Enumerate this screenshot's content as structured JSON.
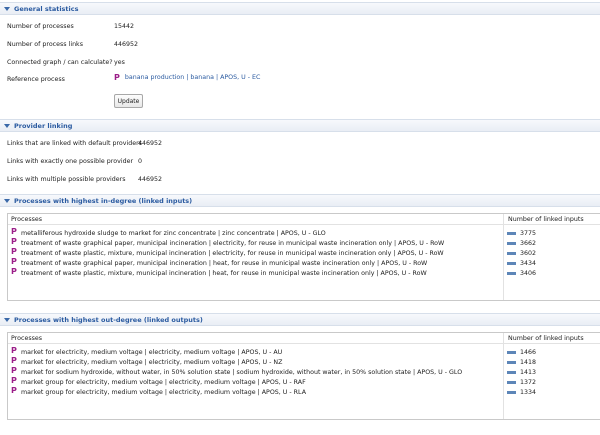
{
  "general": {
    "title": "General statistics",
    "num_processes_label": "Number of processes",
    "num_processes_value": "15442",
    "num_links_label": "Number of process links",
    "num_links_value": "446952",
    "connected_label": "Connected graph / can calculate?",
    "connected_value": "yes",
    "ref_label": "Reference process",
    "ref_value": "banana production | banana | APOS, U - EC",
    "update_label": "Update"
  },
  "linking": {
    "title": "Provider linking",
    "default_label": "Links that are linked with default providers",
    "default_value": "446952",
    "one_label": "Links with exactly one possible provider",
    "one_value": "0",
    "multiple_label": "Links with multiple possible providers",
    "multiple_value": "446952"
  },
  "indegree": {
    "title": "Processes with highest in-degree (linked inputs)",
    "col_processes": "Processes",
    "col_count": "Number of linked inputs",
    "rows": [
      {
        "name": "metalliferous hydroxide sludge to market for zinc concentrate | zinc concentrate | APOS, U - GLO",
        "count": "3775"
      },
      {
        "name": "treatment of waste graphical paper, municipal incineration | electricity, for reuse in municipal waste incineration only | APOS, U - RoW",
        "count": "3662"
      },
      {
        "name": "treatment of waste plastic, mixture, municipal incineration | electricity, for reuse in municipal waste incineration only | APOS, U - RoW",
        "count": "3602"
      },
      {
        "name": "treatment of waste graphical paper, municipal incineration | heat, for reuse in municipal waste incineration only | APOS, U - RoW",
        "count": "3434"
      },
      {
        "name": "treatment of waste plastic, mixture, municipal incineration | heat, for reuse in municipal waste incineration only | APOS, U - RoW",
        "count": "3406"
      }
    ]
  },
  "outdegree": {
    "title": "Processes with highest out-degree (linked outputs)",
    "col_processes": "Processes",
    "col_count": "Number of linked inputs",
    "rows": [
      {
        "name": "market for electricity, medium voltage | electricity, medium voltage | APOS, U - AU",
        "count": "1466"
      },
      {
        "name": "market for electricity, medium voltage | electricity, medium voltage | APOS, U - NZ",
        "count": "1418"
      },
      {
        "name": "market for sodium hydroxide, without water, in 50% solution state | sodium hydroxide, without water, in 50% solution state | APOS, U - GLO",
        "count": "1413"
      },
      {
        "name": "market group for electricity, medium voltage | electricity, medium voltage | APOS, U - RAF",
        "count": "1372"
      },
      {
        "name": "market group for electricity, medium voltage | electricity, medium voltage | APOS, U - RLA",
        "count": "1334"
      }
    ]
  },
  "icons": {
    "process": "P"
  }
}
